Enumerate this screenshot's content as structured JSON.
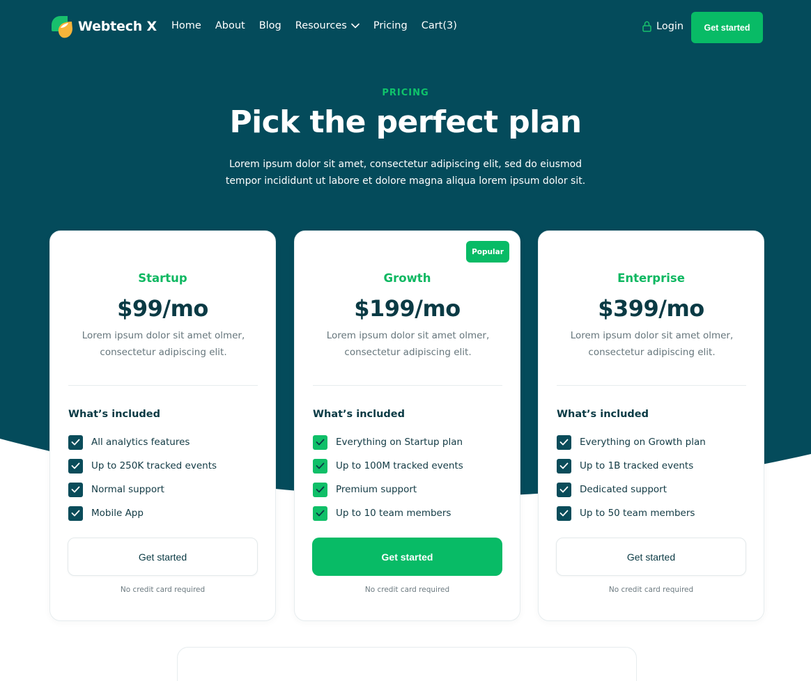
{
  "colors": {
    "hero_bg": "#044b5b",
    "accent": "#08bb66",
    "dark_text": "#0a3a44"
  },
  "nav": {
    "brand": "Webtech X",
    "links": [
      "Home",
      "About",
      "Blog",
      "Resources",
      "Pricing",
      "Cart(3)"
    ],
    "login_label": "Login",
    "cta_label": "Get started"
  },
  "hero": {
    "eyebrow": "PRICING",
    "title": "Pick the perfect plan",
    "subtitle": "Lorem ipsum dolor sit amet, consectetur adipiscing elit, sed do eiusmod tempor incididunt ut labore et dolore magna aliqua lorem ipsum dolor sit."
  },
  "plans": [
    {
      "name": "Startup",
      "price": "$99/mo",
      "description": "Lorem ipsum dolor sit amet olmer, consectetur adipiscing elit.",
      "included_title": "What’s included",
      "features": [
        "All analytics features",
        "Up to 250K tracked events",
        "Normal support",
        "Mobile App"
      ],
      "button_label": "Get started",
      "note": "No credit card required"
    },
    {
      "name": "Growth",
      "badge": "Popular",
      "price": "$199/mo",
      "description": "Lorem ipsum dolor sit amet olmer, consectetur adipiscing elit.",
      "included_title": "What’s included",
      "features": [
        "Everything on Startup plan",
        "Up to 100M tracked events",
        "Premium support",
        "Up to 10 team members"
      ],
      "button_label": "Get started",
      "note": "No credit card required"
    },
    {
      "name": "Enterprise",
      "price": "$399/mo",
      "description": "Lorem ipsum dolor sit amet olmer, consectetur adipiscing elit.",
      "included_title": "What’s included",
      "features": [
        "Everything on Growth plan",
        "Up to 1B tracked events",
        "Dedicated support",
        "Up to 50 team members"
      ],
      "button_label": "Get started",
      "note": "No credit card required"
    }
  ]
}
